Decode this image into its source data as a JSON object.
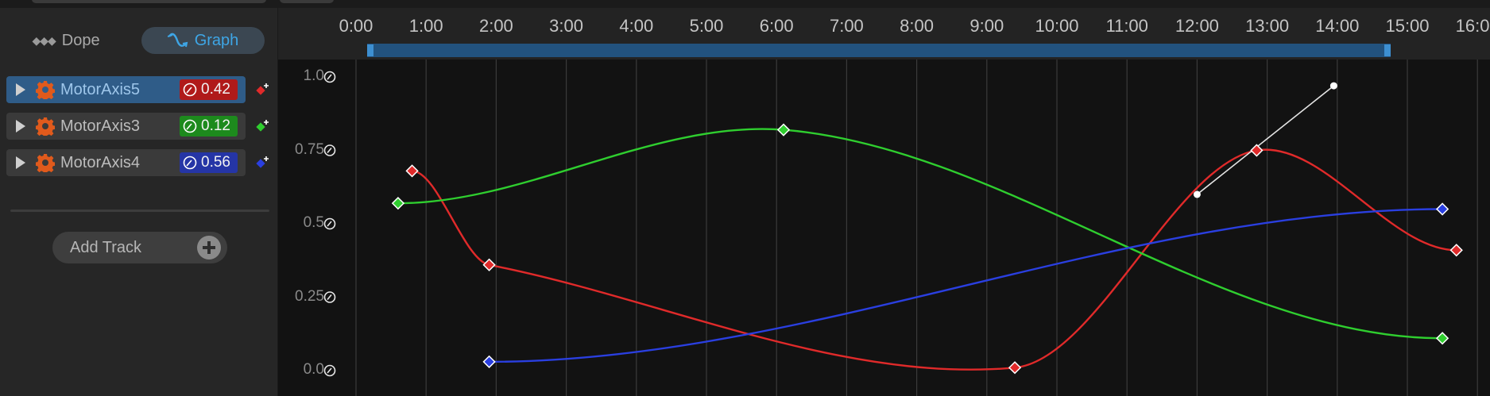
{
  "modes": {
    "dope_label": "Dope",
    "graph_label": "Graph",
    "active": "graph"
  },
  "tracks": [
    {
      "name": "MotorAxis5",
      "value": "0.42",
      "color": "#e02a2a",
      "badge_color": "#b01a1a",
      "selected": true
    },
    {
      "name": "MotorAxis3",
      "value": "0.12",
      "color": "#2fce2f",
      "badge_color": "#1d8a1d",
      "selected": false
    },
    {
      "name": "MotorAxis4",
      "value": "0.56",
      "color": "#2a3fe0",
      "badge_color": "#2535a6",
      "selected": false
    }
  ],
  "add_track_label": "Add Track",
  "ruler": {
    "labels": [
      "0:00",
      "1:00",
      "2:00",
      "3:00",
      "4:00",
      "5:00",
      "6:00",
      "7:00",
      "8:00",
      "9:00",
      "10:00",
      "11:00",
      "12:00",
      "13:00",
      "14:00",
      "15:00",
      "16:00"
    ],
    "view_start": 0.2,
    "view_end": 14.7
  },
  "y_axis": {
    "labels": [
      "1.0",
      "0.75",
      "0.5",
      "0.25",
      "0.0"
    ],
    "values": [
      1.0,
      0.75,
      0.5,
      0.25,
      0.0
    ]
  },
  "curves": [
    {
      "track": "MotorAxis5",
      "color": "#e02a2a",
      "keys": [
        [
          0.8,
          0.68
        ],
        [
          1.9,
          0.36
        ],
        [
          9.4,
          0.01
        ],
        [
          12.85,
          0.75
        ],
        [
          15.7,
          0.41
        ]
      ],
      "tangent_handles": [
        [
          12.0,
          0.6
        ],
        [
          13.95,
          0.97
        ]
      ]
    },
    {
      "track": "MotorAxis3",
      "color": "#2fce2f",
      "keys": [
        [
          0.6,
          0.57
        ],
        [
          6.1,
          0.82
        ],
        [
          15.5,
          0.11
        ]
      ]
    },
    {
      "track": "MotorAxis4",
      "color": "#2a3fe0",
      "keys": [
        [
          1.9,
          0.03
        ],
        [
          15.5,
          0.55
        ]
      ]
    }
  ],
  "colors": {
    "grid": "#3a3a3a",
    "graph_bg": "#121212",
    "accent": "#3ea6e6",
    "gear": "#e05a1c"
  }
}
